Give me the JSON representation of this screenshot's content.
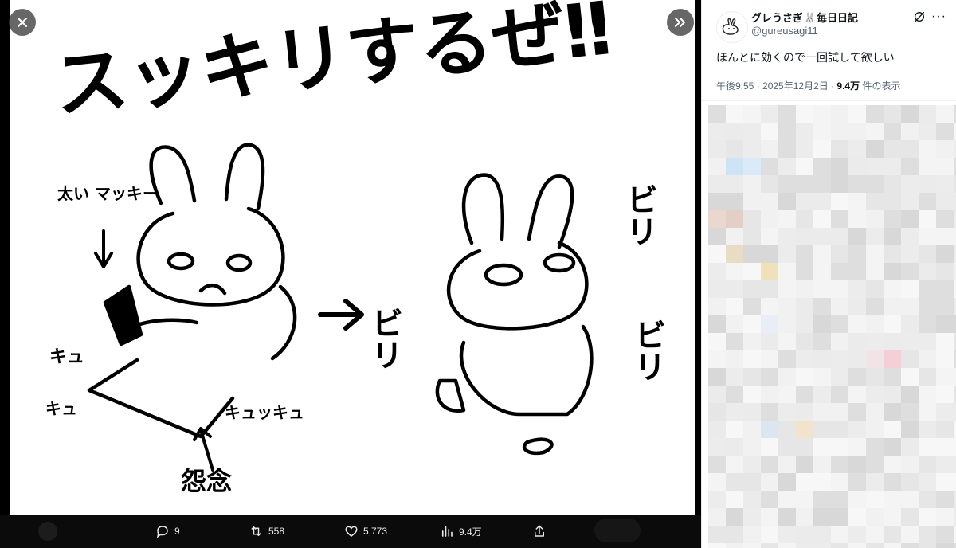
{
  "viewer": {
    "close_icon": "close-icon",
    "next_icon": "double-chevron-right-icon",
    "illustration_text": {
      "headline": "スッキリするぜ‼",
      "marker_label": "太い マッキー",
      "kyu_1": "キュ",
      "kyu_2": "キュ",
      "kyu_3": "キュッキュ",
      "onnen": "怨念",
      "biri_left": "ビリ",
      "biri_right_top": "ビリ",
      "biri_right_bottom": "ビリ"
    },
    "actions": {
      "reply_count": "9",
      "repost_count": "558",
      "like_count": "5,773",
      "views_count": "9.4万"
    }
  },
  "tweet": {
    "display_name": "グレうさぎ",
    "display_name_emoji": "🐰",
    "display_name_suffix": "毎日日記",
    "handle": "@gureusagi11",
    "text": "ほんとに効くので一回試して欲しい",
    "timestamp": "午後9:55 · 2025年12月2日 ·",
    "views_value": "9.4万",
    "views_label": "件の表示",
    "more_icon": "more-icon",
    "grok_icon": "grok-icon"
  },
  "colors": {
    "background": "#000000",
    "panel": "#ffffff",
    "text_primary": "#0f1419",
    "text_secondary": "#536471",
    "accent_blue": "#1d9bf0"
  }
}
